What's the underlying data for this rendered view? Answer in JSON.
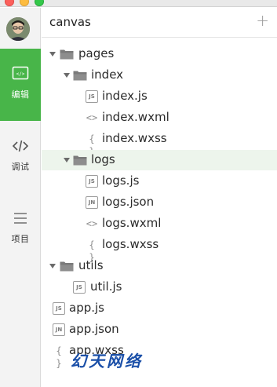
{
  "rail": {
    "items": [
      {
        "label": "编辑",
        "icon": "editor-icon",
        "active": true
      },
      {
        "label": "调试",
        "icon": "debug-code-icon",
        "active": false
      },
      {
        "label": "项目",
        "icon": "project-menu-icon",
        "active": false
      }
    ]
  },
  "explorer": {
    "title": "canvas",
    "add_label": "+",
    "tree": {
      "pages": "pages",
      "index": "index",
      "index_js": "index.js",
      "index_wxml": "index.wxml",
      "index_wxss": "index.wxss",
      "logs": "logs",
      "logs_js": "logs.js",
      "logs_json": "logs.json",
      "logs_wxml": "logs.wxml",
      "logs_wxss": "logs.wxss",
      "utils": "utils",
      "util_js": "util.js",
      "app_js": "app.js",
      "app_json": "app.json",
      "app_wxss": "app.wxss"
    },
    "badges": {
      "js": "JS",
      "json": "JN",
      "wxml": "<>",
      "wxss": "{ }"
    },
    "selected": "logs"
  },
  "watermark": "幻天网络",
  "colors": {
    "accent": "#48b549",
    "selected_row": "#edf5ec",
    "watermark": "#1a4fa8"
  }
}
